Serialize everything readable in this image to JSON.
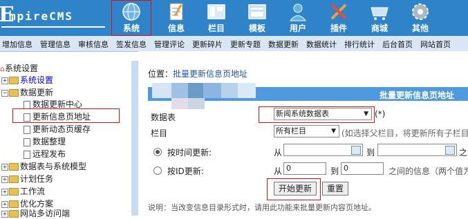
{
  "app": {
    "logo_text": "mpireCMS",
    "logo_initial": "E"
  },
  "topnav": [
    {
      "label": "系统",
      "icon": "globe-icon"
    },
    {
      "label": "信息",
      "icon": "notepad-icon"
    },
    {
      "label": "栏目",
      "icon": "columns-icon"
    },
    {
      "label": "模板",
      "icon": "template-icon"
    },
    {
      "label": "用户",
      "icon": "user-icon"
    },
    {
      "label": "插件",
      "icon": "tools-icon"
    },
    {
      "label": "商城",
      "icon": "shop-icon"
    },
    {
      "label": "其他",
      "icon": "gear-icon"
    }
  ],
  "menu": [
    "增加信息",
    "管理信息",
    "审核信息",
    "签发信息",
    "管理评论",
    "更新碎片",
    "更新专题",
    "数据更新",
    "数据统计",
    "排行统计",
    "后台首页",
    "网站首页"
  ],
  "tree": {
    "root": "系统设置",
    "items": [
      {
        "label": "系统设置",
        "level": 1,
        "type": "folder",
        "link": true
      },
      {
        "label": "数据更新",
        "level": 1,
        "type": "folder",
        "link": false
      },
      {
        "label": "数据更新中心",
        "level": 2,
        "type": "page"
      },
      {
        "label": "更新信息页地址",
        "level": 2,
        "type": "page"
      },
      {
        "label": "更新动态页缓存",
        "level": 2,
        "type": "page"
      },
      {
        "label": "数据整理",
        "level": 2,
        "type": "page"
      },
      {
        "label": "远程发布",
        "level": 2,
        "type": "page"
      },
      {
        "label": "数据表与系统模型",
        "level": 1,
        "type": "folder"
      },
      {
        "label": "计划任务",
        "level": 1,
        "type": "folder"
      },
      {
        "label": "工作流",
        "level": 1,
        "type": "folder"
      },
      {
        "label": "优化方案",
        "level": 1,
        "type": "folder"
      },
      {
        "label": "网站多访问端",
        "level": 1,
        "type": "folder"
      }
    ]
  },
  "content": {
    "breadcrumb_prefix": "位置：",
    "breadcrumb_link": "批量更新信息页地址",
    "table_title": "批量更新信息页地址",
    "table_label": "数据表",
    "table_value": "新闻系统数据表",
    "table_hint": "(*)",
    "column_label": "栏目",
    "column_value": "所有栏目",
    "column_hint": "(如选择父栏目，将更新所有子栏目",
    "by_time_label": "按时间更新:",
    "from_label": "从",
    "to_label": "到",
    "time_tail": "之",
    "by_id_label": "按ID更新:",
    "id_from": "0",
    "id_to": "0",
    "id_tail": "之间的信息（两个值为",
    "start_button": "开始更新",
    "reset_button": "重置",
    "note": "说明：当改变信息目录形式时，请用此功能来批量更新内容页地址。"
  },
  "colors": {
    "nav_bg": "#2e83c9",
    "menu_bg": "#d9e7f5",
    "header_bg": "#4f9adf",
    "highlight": "#dd1111"
  }
}
